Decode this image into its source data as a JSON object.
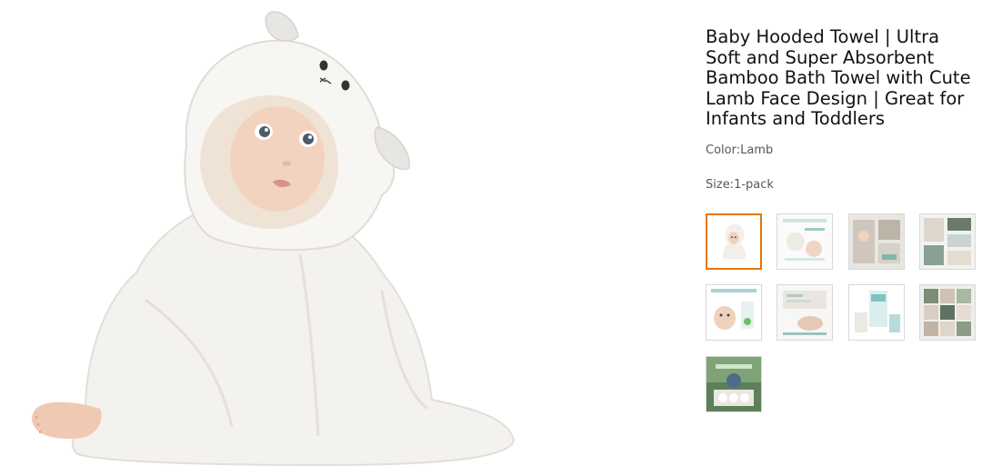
{
  "product": {
    "title_lines": [
      "Baby Hooded Towel | Ultra",
      "Soft and Super Absorbent",
      "Bamboo Bath Towel with Cute",
      "Lamb Face Design | Great for",
      "Infants and Toddlers"
    ],
    "color_label": "Color:",
    "color_value": "Lamb",
    "size_label": "Size:",
    "size_value": "1-pack"
  },
  "thumbnails": {
    "count": 9,
    "selected_index": 0,
    "accent_color": "#e77600"
  }
}
